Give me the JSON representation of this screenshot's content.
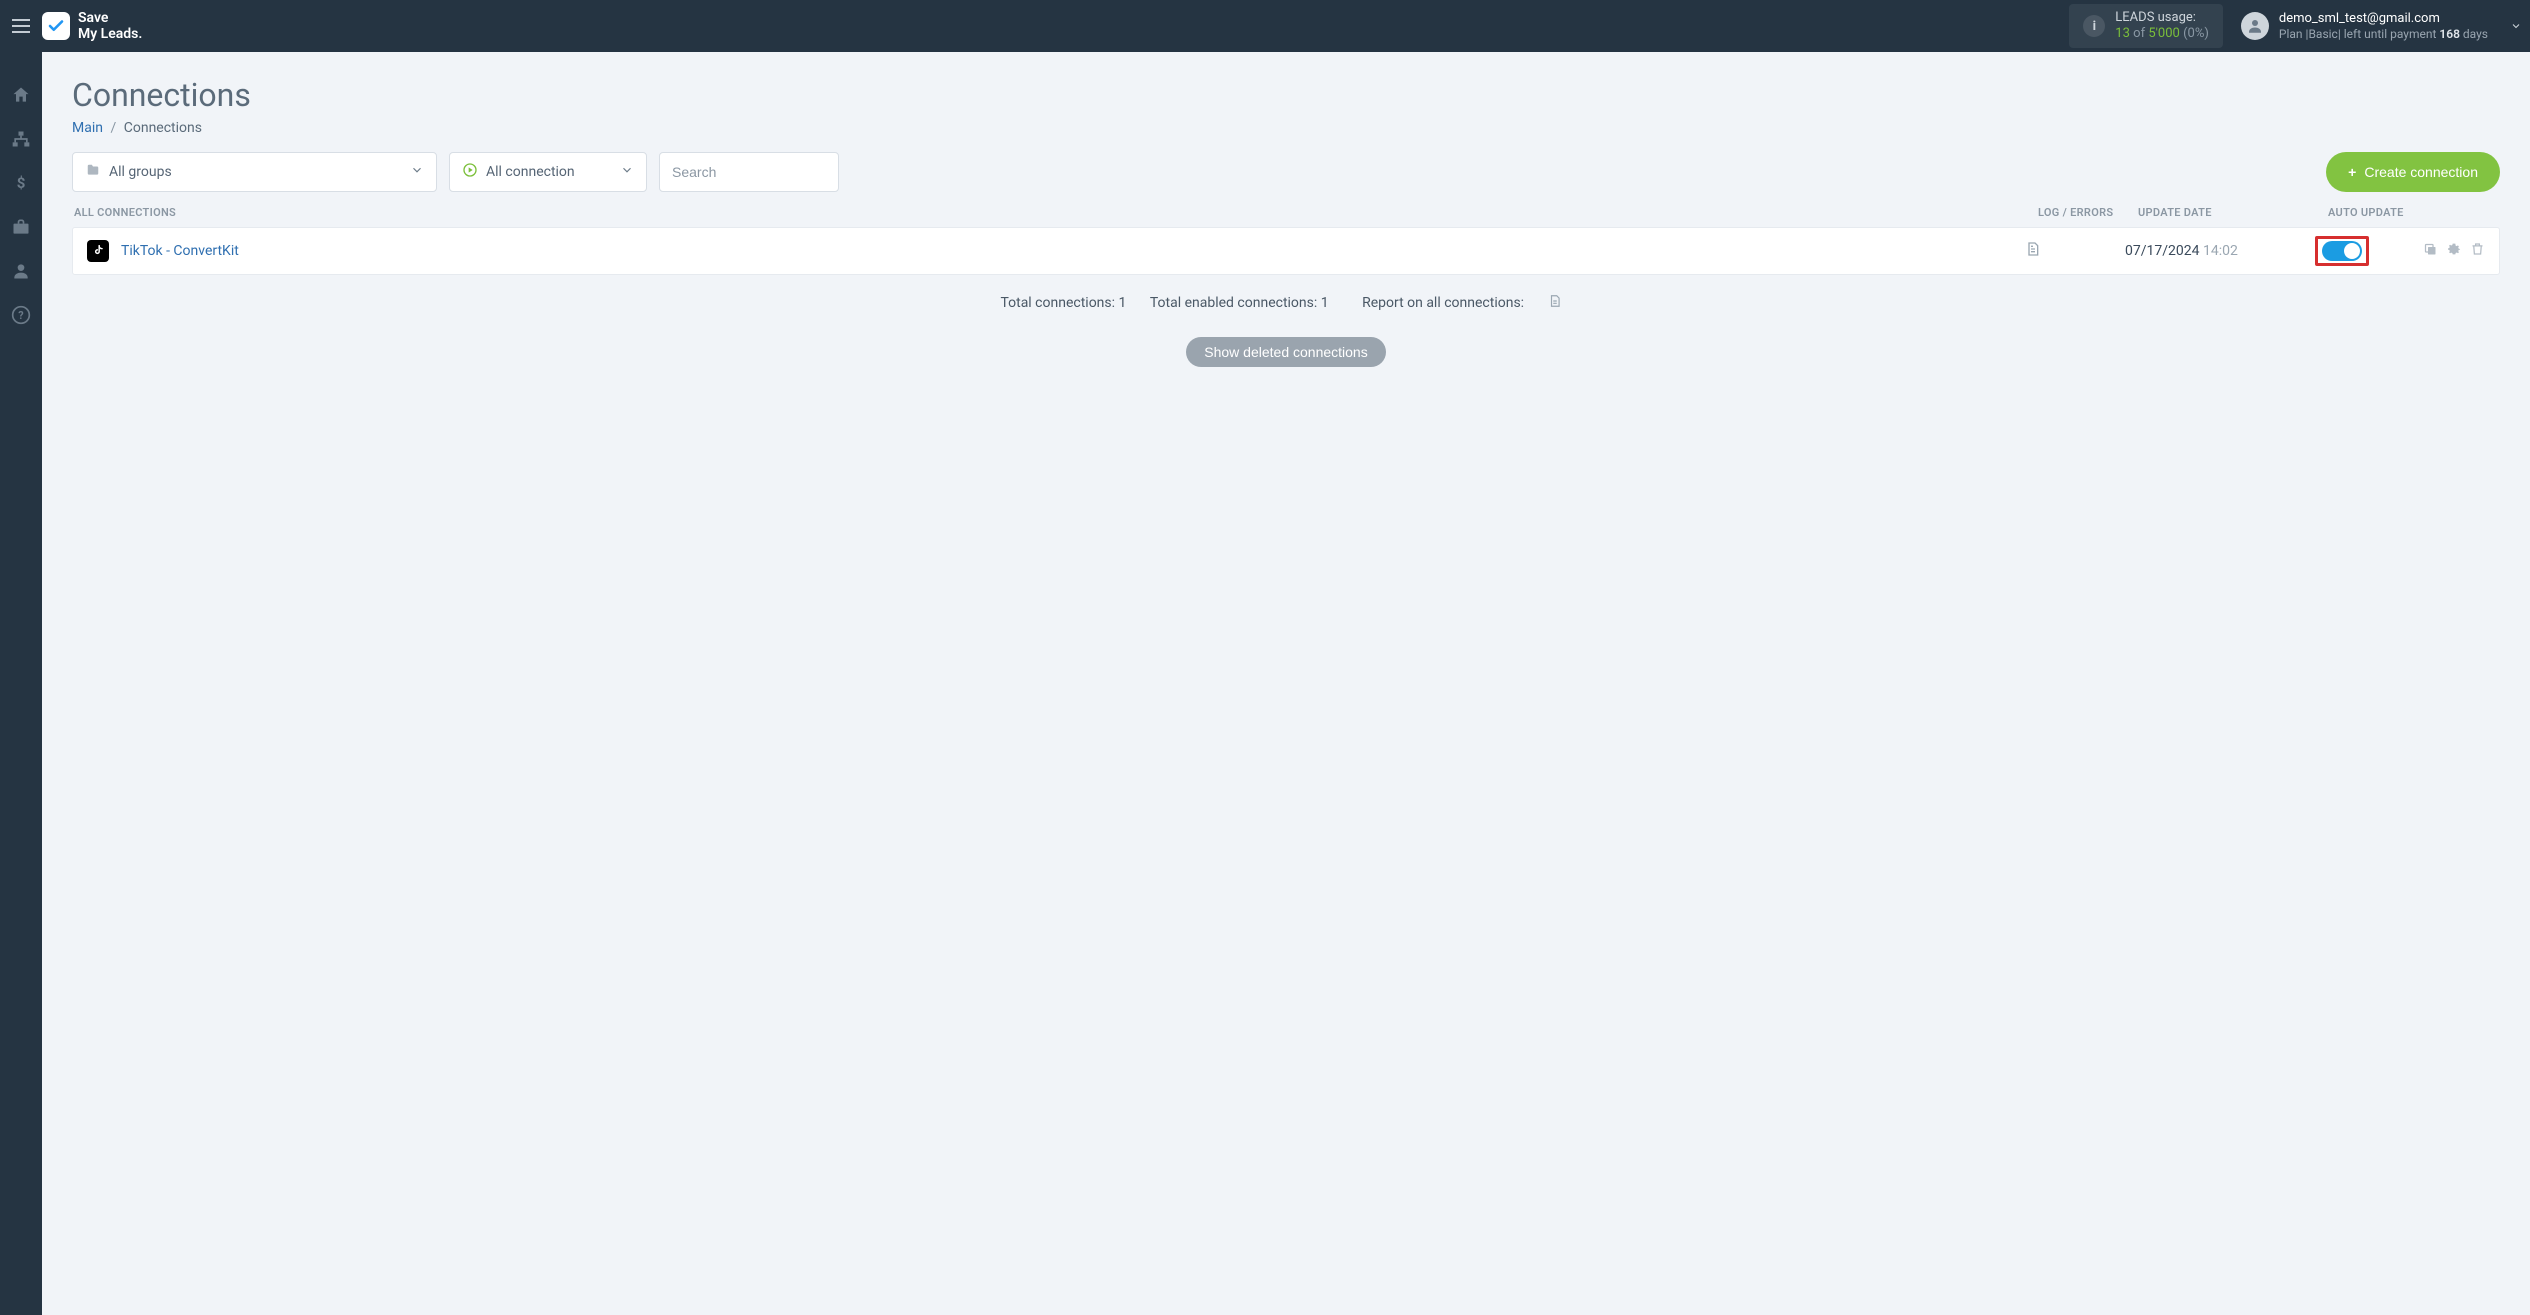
{
  "brand": {
    "line1": "Save",
    "line2": "My Leads."
  },
  "header": {
    "leads": {
      "label": "LEADS usage:",
      "used": "13",
      "of": "of",
      "limit": "5'000",
      "pct": "(0%)"
    },
    "user": {
      "email": "demo_sml_test@gmail.com",
      "plan_prefix": "Plan |",
      "plan_name": "Basic",
      "plan_mid": "| left until payment ",
      "days": "168",
      "plan_suffix": " days"
    }
  },
  "page": {
    "title": "Connections"
  },
  "breadcrumb": {
    "main": "Main",
    "current": "Connections"
  },
  "filters": {
    "groups": "All groups",
    "status": "All connection",
    "search_placeholder": "Search",
    "create": "Create connection"
  },
  "table": {
    "head": {
      "name": "ALL CONNECTIONS",
      "log": "LOG / ERRORS",
      "date": "UPDATE DATE",
      "auto": "AUTO UPDATE"
    },
    "rows": [
      {
        "name": "TikTok - ConvertKit",
        "date": "07/17/2024",
        "time": "14:02"
      }
    ]
  },
  "summary": {
    "total": "Total connections: 1",
    "enabled": "Total enabled connections: 1",
    "report": "Report on all connections:"
  },
  "buttons": {
    "show_deleted": "Show deleted connections"
  }
}
